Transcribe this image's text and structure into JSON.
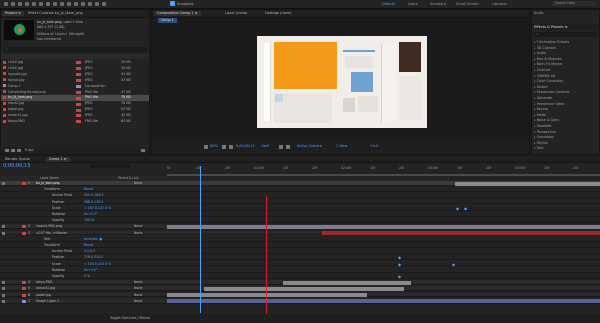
{
  "menu": {
    "workspaces": [
      "Default",
      "Learn",
      "Standard",
      "Small Screen",
      "Libraries"
    ],
    "active_workspace": "Default",
    "snapping_label": "Snapping",
    "search_placeholder": "Search Help"
  },
  "project": {
    "tabs": [
      "Project ≡",
      "Effect Controls ku_jk_tkom_png"
    ],
    "preview_name": "ku_jk_kom.png",
    "preview_used": "used 1 time",
    "preview_size": "600 x 337 (1.00)",
    "preview_colors": "Millions of Colors+ (Straight)",
    "preview_interlace": "non-interlaced",
    "search_placeholder": "⌕",
    "files": [
      {
        "name": "Link2.jpg",
        "type": "JPEG",
        "size": "59 KB",
        "color": "#c24a4a"
      },
      {
        "name": "Link2.jpg",
        "type": "JPEG",
        "size": "36 KB",
        "color": "#c24a4a"
      },
      {
        "name": "layout4.jpg",
        "type": "JPEG",
        "size": "41 KB",
        "color": "#c24a4a"
      },
      {
        "name": "layout.jpg",
        "type": "JPEG",
        "size": "53 KB",
        "color": "#c24a4a"
      },
      {
        "name": "Comp 1",
        "type": "Composition",
        "size": "",
        "color": "#8b8bd6"
      },
      {
        "name": "Converting format.png",
        "type": "PNG file",
        "size": "47 KB",
        "color": "#c24a4a"
      },
      {
        "name": "ku_jk_kom.png",
        "type": "PNG file",
        "size": "78 KB",
        "color": "#c24a4a"
      },
      {
        "name": "hands.jpg",
        "type": "JPEG",
        "size": "76 KB",
        "color": "#c24a4a"
      },
      {
        "name": "paper.jpg",
        "type": "JPEG",
        "size": "63 KB",
        "color": "#c24a4a"
      },
      {
        "name": "unnact1.jpg",
        "type": "JPEG",
        "size": "42 KB",
        "color": "#c24a4a"
      },
      {
        "name": "tokyo.PNG",
        "type": "PNG file",
        "size": "63 KB",
        "color": "#c24a4a"
      }
    ],
    "bpc": "8 bpc"
  },
  "viewer": {
    "tabs": [
      "Composition Comp 1 ≡",
      "Layer (none)",
      "Footage (none)"
    ],
    "comp_tab": "Comp 1",
    "zoom": "50%",
    "timecode": "0;00;00;13",
    "resolution": "Half",
    "camera": "Active Camera",
    "views": "1 View",
    "offset": "+0.0"
  },
  "effects": {
    "header": "Audio",
    "title": "Effects & Presets ≡",
    "search_placeholder": "⌕",
    "items": [
      "* Animation Presets",
      "3D Channel",
      "Audio",
      "Blur & Sharpen",
      "Boris FX Mocha",
      "Channel",
      "CINEMA 4D",
      "Color Correction",
      "Distort",
      "Expression Controls",
      "Generate",
      "Immersive Video",
      "Keying",
      "Matte",
      "Noise & Grain",
      "Obsolete",
      "Perspective",
      "Simulation",
      "Stylize",
      "Text"
    ]
  },
  "timeline": {
    "tabs": [
      "Render Queue",
      "Comp 1 ≡"
    ],
    "timecode": "0;00;00;13",
    "col_header": "Layer Name",
    "col_parent": "Parent & Link",
    "ruler": [
      "0f",
      "10f",
      "20f",
      "01:00f",
      "10f",
      "20f",
      "02:00f",
      "10f",
      "20f",
      "03:00f",
      "10f",
      "20f",
      "04:00f",
      "10f",
      "20f"
    ],
    "footer": "Toggle Switches / Modes",
    "rows": [
      {
        "num": "1",
        "name": "ku_jk_kom.png",
        "parent": "None",
        "indent": 0,
        "sel": true,
        "color": "#c24a4a"
      },
      {
        "num": "",
        "name": "Transform",
        "parent": "Reset",
        "indent": 1,
        "sel": false,
        "color": ""
      },
      {
        "num": "",
        "name": "Anchor Point",
        "parent": "300.0,184.5",
        "indent": 2,
        "sel": false,
        "color": ""
      },
      {
        "num": "",
        "name": "Position",
        "parent": "388.0,126.5",
        "indent": 2,
        "sel": false,
        "color": ""
      },
      {
        "num": "",
        "name": "Scale",
        "parent": "⊂ 167.0,121.0 %",
        "indent": 2,
        "sel": false,
        "color": ""
      },
      {
        "num": "",
        "name": "Rotation",
        "parent": "0x+0.0°",
        "indent": 2,
        "sel": false,
        "color": ""
      },
      {
        "num": "",
        "name": "Opacity",
        "parent": "100 %",
        "indent": 2,
        "sel": false,
        "color": ""
      },
      {
        "num": "2",
        "name": "lnostr4-PNG.png",
        "parent": "None",
        "indent": 0,
        "sel": false,
        "color": "#c24a4a"
      },
      {
        "num": "3",
        "name": "<247 Mo...e Marker",
        "parent": "None",
        "indent": 0,
        "sel": false,
        "color": "#c24a4a"
      },
      {
        "num": "",
        "name": "Text",
        "parent": "Animate: ●",
        "indent": 1,
        "sel": false,
        "color": ""
      },
      {
        "num": "",
        "name": "Transform",
        "parent": "Reset",
        "indent": 1,
        "sel": false,
        "color": ""
      },
      {
        "num": "",
        "name": "Anchor Point",
        "parent": "0.0,0.0",
        "indent": 2,
        "sel": false,
        "color": ""
      },
      {
        "num": "",
        "name": "Position",
        "parent": "236.0,320.0",
        "indent": 2,
        "sel": false,
        "color": ""
      },
      {
        "num": "",
        "name": "Scale",
        "parent": "⊂ 104.9,104.9 %",
        "indent": 2,
        "sel": false,
        "color": ""
      },
      {
        "num": "",
        "name": "Rotation",
        "parent": "0x+0.0°",
        "indent": 2,
        "sel": false,
        "color": ""
      },
      {
        "num": "",
        "name": "Opacity",
        "parent": "0 %",
        "indent": 2,
        "sel": false,
        "color": ""
      },
      {
        "num": "4",
        "name": "tokyo.PNG",
        "parent": "None",
        "indent": 0,
        "sel": false,
        "color": "#c24a4a"
      },
      {
        "num": "5",
        "name": "unnact1.jpg",
        "parent": "None",
        "indent": 0,
        "sel": false,
        "color": "#c24a4a"
      },
      {
        "num": "6",
        "name": "paper.jpg",
        "parent": "None",
        "indent": 0,
        "sel": false,
        "color": "#c24a4a"
      },
      {
        "num": "7",
        "name": "Shape Layer 1",
        "parent": "None",
        "indent": 0,
        "sel": false,
        "color": "#8b8bd6"
      }
    ]
  }
}
